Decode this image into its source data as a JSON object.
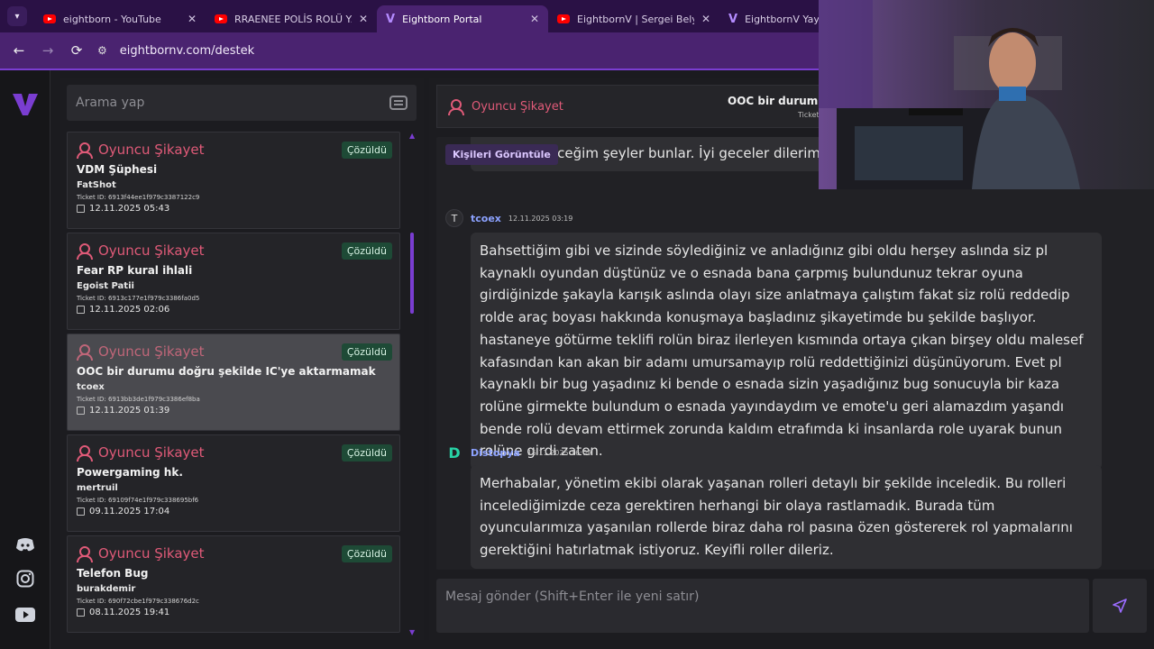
{
  "browser": {
    "tabs": [
      {
        "title": "eightborn - YouTube",
        "icon": "youtube-icon"
      },
      {
        "title": "RRAENEE POLİS ROLÜ YAP",
        "icon": "youtube-icon"
      },
      {
        "title": "Eightborn Portal",
        "icon": "v-logo-icon",
        "active": true
      },
      {
        "title": "EightbornV | Sergei Belyak",
        "icon": "youtube-icon"
      },
      {
        "title": "EightbornV Yayıncıla",
        "icon": "v-logo-icon"
      }
    ],
    "url": "eightbornv.com/destek"
  },
  "search": {
    "placeholder": "Arama yap"
  },
  "tickets": [
    {
      "category": "Oyuncu Şikayet",
      "status": "Çözüldü",
      "subject": "VDM Şüphesi",
      "user": "FatShot",
      "ticket_id": "Ticket ID: 6913f44ee1f979c3387122c9",
      "date": "12.11.2025 05:43"
    },
    {
      "category": "Oyuncu Şikayet",
      "status": "Çözüldü",
      "subject": "Fear RP kural ihlali",
      "user": "Egoist Patii",
      "ticket_id": "Ticket ID: 6913c177e1f979c3386fa0d5",
      "date": "12.11.2025 02:06"
    },
    {
      "category": "Oyuncu Şikayet",
      "status": "Çözüldü",
      "subject": "OOC bir durumu doğru şekilde IC'ye aktarmamak",
      "user": "tcoex",
      "ticket_id": "Ticket ID: 6913bb3de1f979c3386ef8ba",
      "date": "12.11.2025 01:39",
      "selected": true
    },
    {
      "category": "Oyuncu Şikayet",
      "status": "Çözüldü",
      "subject": "Powergaming hk.",
      "user": "mertruil",
      "ticket_id": "Ticket ID: 69109f74e1f979c338695bf6",
      "date": "09.11.2025 17:04"
    },
    {
      "category": "Oyuncu Şikayet",
      "status": "Çözüldü",
      "subject": "Telefon Bug",
      "user": "burakdemir",
      "ticket_id": "Ticket ID: 690f72cbe1f979c338676d2c",
      "date": "08.11.2025 19:41"
    }
  ],
  "chat": {
    "header_category": "Oyuncu Şikayet",
    "header_subject": "OOC bir durumu d",
    "header_ticket_label": "Ticket",
    "participants_button": "Kişileri Görüntüle",
    "prev_message_tail": "Söyleyebileceğim şeyler bunlar. İyi geceler dilerim.",
    "messages": [
      {
        "avatar": "T",
        "author": "tcoex",
        "time": "12.11.2025 03:19",
        "text": "Bahsettiğim gibi ve sizinde söylediğiniz ve anladığınız gibi oldu herşey aslında siz pl kaynaklı oyundan düştünüz ve o esnada bana çarpmış bulundunuz tekrar oyuna girdiğinizde şakayla karışık aslında olayı size anlatmaya çalıştım fakat siz rolü reddedip rolde araç boyası hakkında konuşmaya başladınız şikayetimde bu şekilde başlıyor. hastaneye götürme teklifi rolün biraz ilerleyen kısmında ortaya çıkan birşey oldu malesef kafasından kan akan bir adamı umursamayıp rolü reddettiğinizi düşünüyorum. Evet pl kaynaklı bir bug yaşadınız ki bende o esnada sizin yaşadığınız bug sonucuyla bir kaza rolüne girmekte bulundum o esnada yayındaydım ve emote'u geri alamazdım yaşandı bende rolü devam ettirmek zorunda kaldım etrafımda ki insanlarda role uyarak bunun rolüne girdi zaten."
      },
      {
        "avatar": "D",
        "author": "Distopya",
        "time": "15.11.2025 16:09",
        "text": "Merhabalar, yönetim ekibi olarak yaşanan rolleri detaylı bir şekilde inceledik. Bu rolleri incelediğimizde ceza gerektiren herhangi bir olaya rastlamadık. Burada tüm oyuncularımıza yaşanılan rollerde biraz daha rol pasına özen göstererek rol yapmalarını gerektiğini hatırlatmak istiyoruz. Keyifli roller dileriz."
      }
    ],
    "composer_placeholder": "Mesaj gönder (Shift+Enter ile yeni satır)"
  },
  "colors": {
    "accent": "#7a3dd1",
    "category": "#e05a78",
    "resolved_badge": "#1e4a36",
    "author": "#8ca2ff"
  },
  "rail_icons": [
    "discord-icon",
    "instagram-icon",
    "youtube-icon"
  ]
}
